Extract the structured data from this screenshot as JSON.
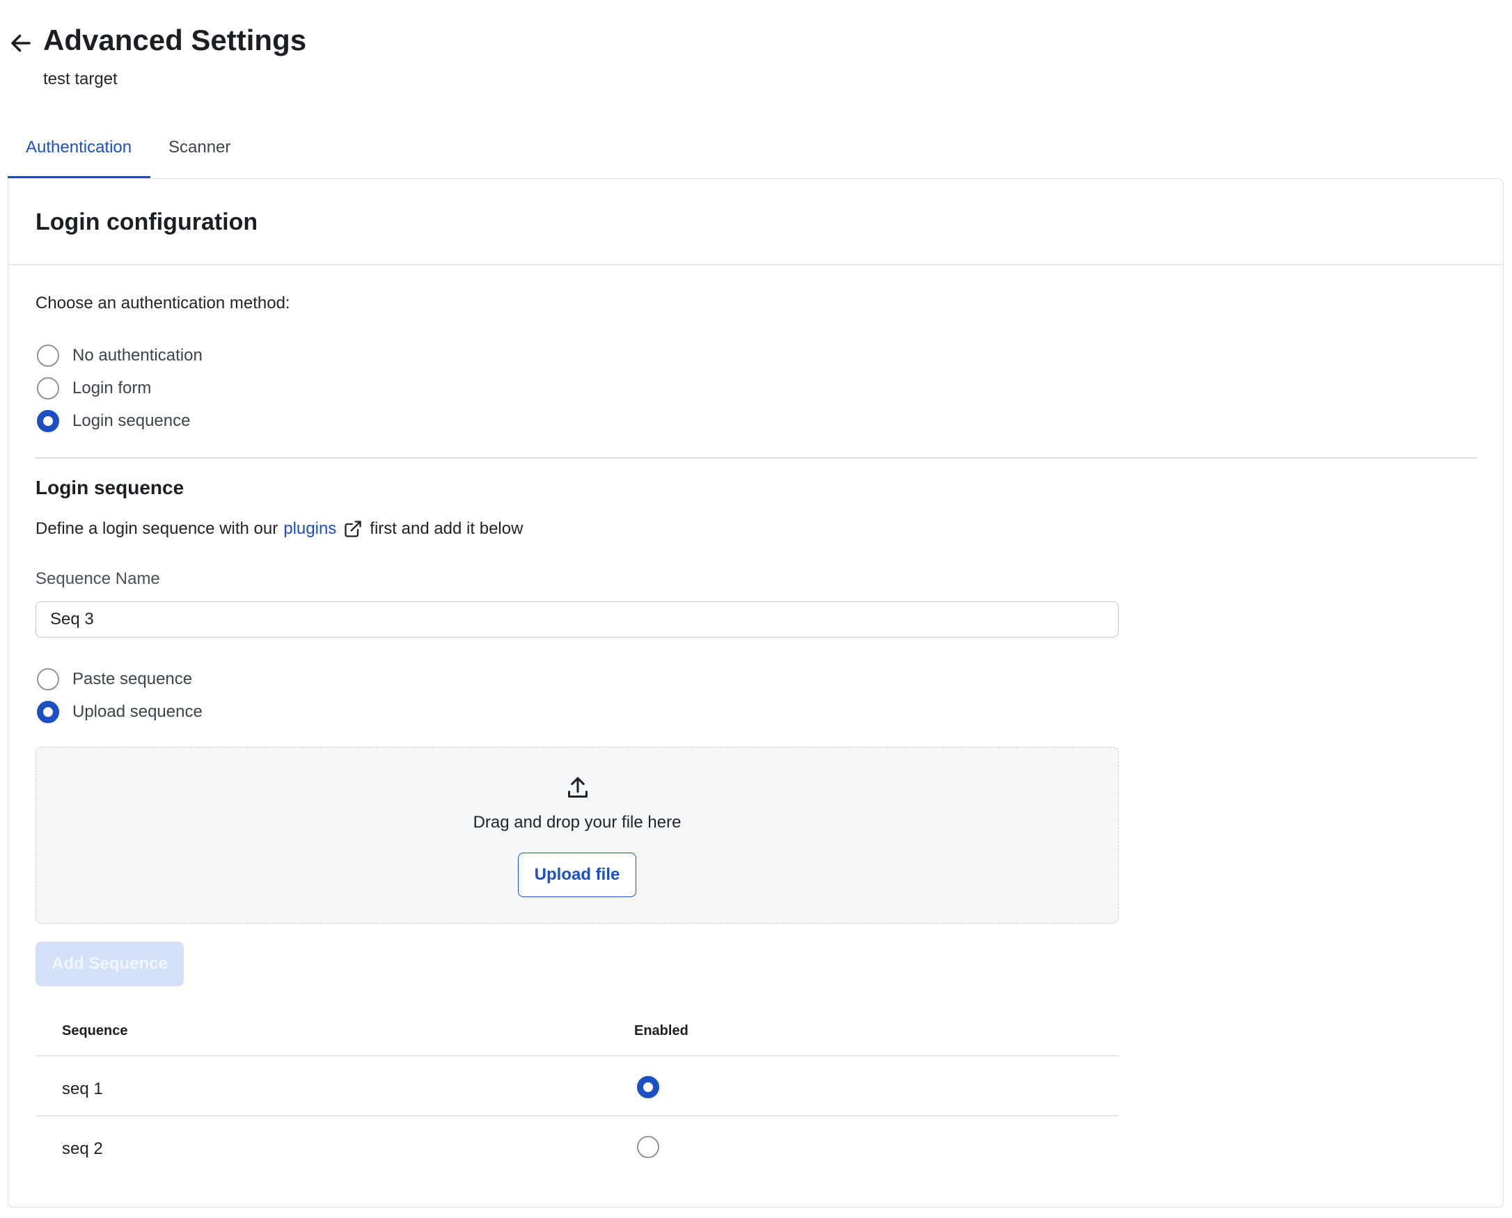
{
  "header": {
    "title": "Advanced Settings",
    "subtitle": "test target"
  },
  "tabs": [
    {
      "label": "Authentication",
      "active": true
    },
    {
      "label": "Scanner",
      "active": false
    }
  ],
  "card": {
    "title": "Login configuration",
    "instruction": "Choose an authentication method:",
    "auth_methods": [
      {
        "label": "No authentication",
        "selected": false
      },
      {
        "label": "Login form",
        "selected": false
      },
      {
        "label": "Login sequence",
        "selected": true
      }
    ],
    "section_title": "Login sequence",
    "description_before": "Define a login sequence with our",
    "description_link": "plugins",
    "description_after": "first and add it below",
    "sequence_name_label": "Sequence Name",
    "sequence_name_value": "Seq 3",
    "sequence_source": [
      {
        "label": "Paste sequence",
        "selected": false
      },
      {
        "label": "Upload sequence",
        "selected": true
      }
    ],
    "dropzone_text": "Drag and drop your file here",
    "upload_button": "Upload file",
    "add_button": "Add Sequence",
    "table": {
      "headers": [
        "Sequence",
        "Enabled"
      ],
      "rows": [
        {
          "name": "seq 1",
          "enabled": true
        },
        {
          "name": "seq 2",
          "enabled": false
        }
      ]
    }
  },
  "colors": {
    "accent": "#1d4fc4",
    "disabled_button_bg": "#d3e0f7",
    "border": "#dcdfe3",
    "dropzone_bg": "#f6f7f9"
  },
  "icons": [
    "arrow-left-icon",
    "external-link-icon",
    "upload-icon"
  ]
}
